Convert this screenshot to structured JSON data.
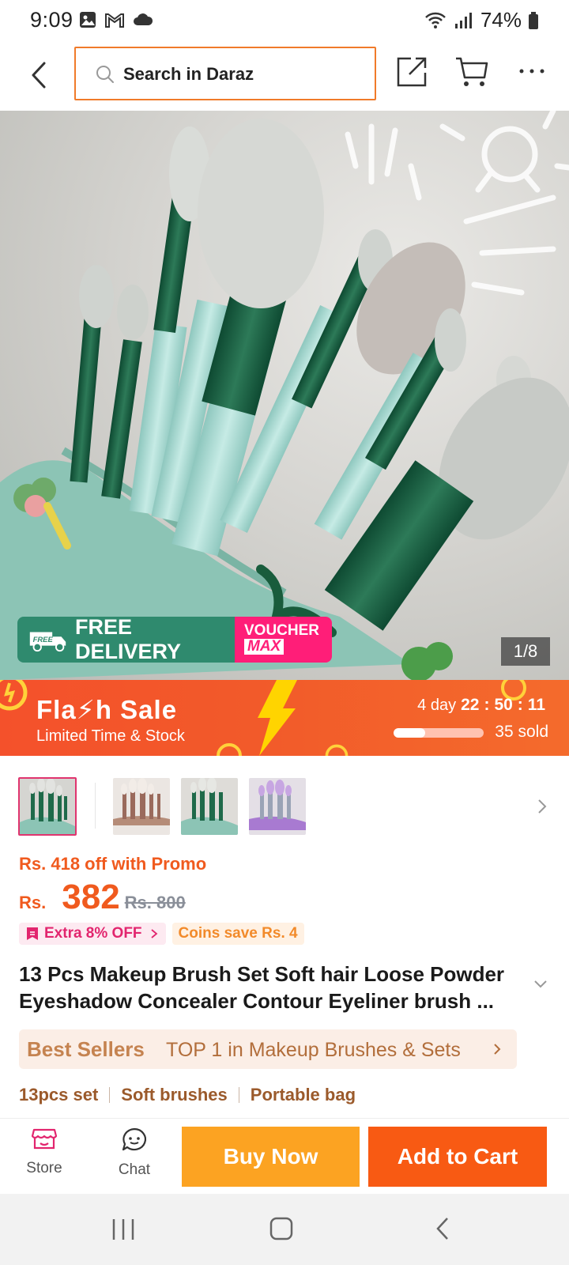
{
  "status_bar": {
    "time": "9:09",
    "battery": "74%",
    "icons": [
      "gallery-icon",
      "gmail-icon",
      "cloud-icon",
      "wifi-icon",
      "signal-icon",
      "battery-icon"
    ]
  },
  "header": {
    "search_placeholder": "Search in Daraz"
  },
  "hero": {
    "pager": "1/8",
    "free_delivery": "FREE DELIVERY",
    "free_tag": "FREE",
    "voucher_line1": "VOUCHER",
    "voucher_line2": "MAX"
  },
  "flash_sale": {
    "title": "Fla⚡h  Sale",
    "subtitle": "Limited Time & Stock",
    "days": "4 day",
    "hours": "22",
    "minutes": "50",
    "seconds": "11",
    "sold": "35 sold",
    "sold_progress": 0.35
  },
  "thumbnails": [
    {
      "name": "green-brush-set",
      "selected": true
    },
    {
      "name": "rose-brush-set",
      "selected": false
    },
    {
      "name": "green-brush-set-2",
      "selected": false
    },
    {
      "name": "purple-brush-set",
      "selected": false
    }
  ],
  "price": {
    "promo": "Rs. 418 off with Promo",
    "currency": "Rs.",
    "current": "382",
    "original": "Rs. 800",
    "chip_extra": "Extra 8% OFF",
    "chip_coins": "Coins save Rs. 4"
  },
  "product": {
    "title_line1": "13 Pcs Makeup Brush Set Soft hair Loose Powder",
    "title_line2": "Eyeshadow Concealer Contour Eyeliner brush ..."
  },
  "best_sellers": {
    "label": "Best Sellers",
    "rank": "TOP 1 in Makeup Brushes & Sets"
  },
  "tags": [
    "13pcs set",
    "Soft brushes",
    "Portable bag"
  ],
  "bottom_bar": {
    "store": "Store",
    "chat": "Chat",
    "buy_now": "Buy Now",
    "add_to_cart": "Add to Cart"
  },
  "colors": {
    "brand_orange": "#f85a13",
    "buy_yellow": "#fca322",
    "flash_red": "#f4512b",
    "green": "#2f8a6e",
    "pink": "#ff1e78"
  }
}
